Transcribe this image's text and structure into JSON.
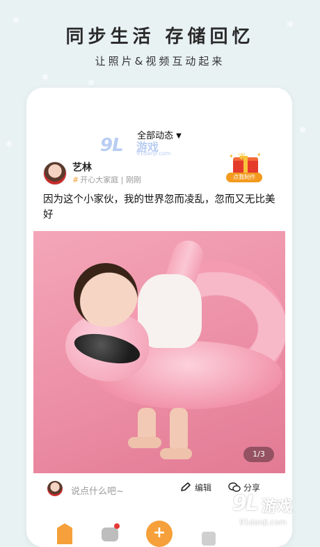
{
  "hero": {
    "title": "同步生活 存储回忆",
    "subtitle": "让照片&视频互动起来"
  },
  "feed": {
    "filter_label": "全部动态"
  },
  "watermark_small": {
    "mark": "9L",
    "brand": "游戏",
    "url": "91danji.com"
  },
  "post": {
    "author": "艺林",
    "family": "开心大家庭",
    "separator": "|",
    "time": "刚刚",
    "caption": "因为这个小家伙，我的世界忽而凌乱，忽而又无比美好",
    "photo_counter": "1/3"
  },
  "gift": {
    "label": "点我制作"
  },
  "actions": {
    "comment_placeholder": "说点什么吧~",
    "edit_label": "编辑",
    "share_label": "分享"
  },
  "tabbar": {
    "plus": "+"
  },
  "watermark_big": {
    "mark": "9L",
    "brand": "游戏",
    "url": "91danji.com"
  },
  "colors": {
    "accent": "#f5a03a",
    "background": "#e9f2f3",
    "photo": "#ec8fa6"
  }
}
